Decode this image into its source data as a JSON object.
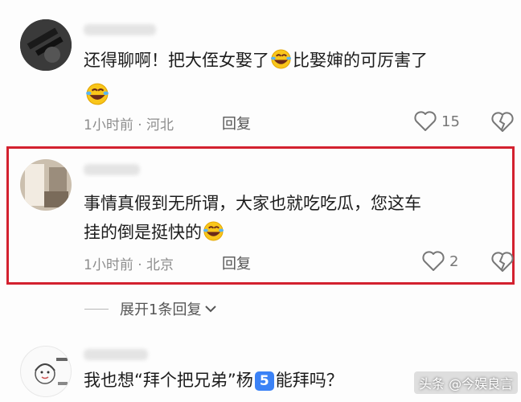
{
  "comments": [
    {
      "text_line1": "还得聊啊！把大侄女娶了",
      "text_line1_tail": "比娶婶的可厉害了",
      "time": "1小时前",
      "location": "河北",
      "reply_label": "回复",
      "likes": "15"
    },
    {
      "text_line1": "事情真假到无所谓，大家也就吃吃瓜，您这车",
      "text_line2": "挂的倒是挺快的",
      "time": "1小时前",
      "location": "北京",
      "reply_label": "回复",
      "likes": "2"
    },
    {
      "text_prefix": "我也想“拜个把兄弟”杨",
      "badge": "5",
      "text_suffix": "能拜吗？"
    }
  ],
  "expand_replies": "展开1条回复",
  "meta_separator": "·",
  "watermark": "头条 @今娱良言",
  "colors": {
    "highlight_border": "#d3212f",
    "emoji_face": "#f9c61a"
  },
  "icons": [
    "laughing-crying-emoji-icon",
    "heart-outline-icon",
    "broken-heart-icon",
    "chevron-down-icon"
  ]
}
